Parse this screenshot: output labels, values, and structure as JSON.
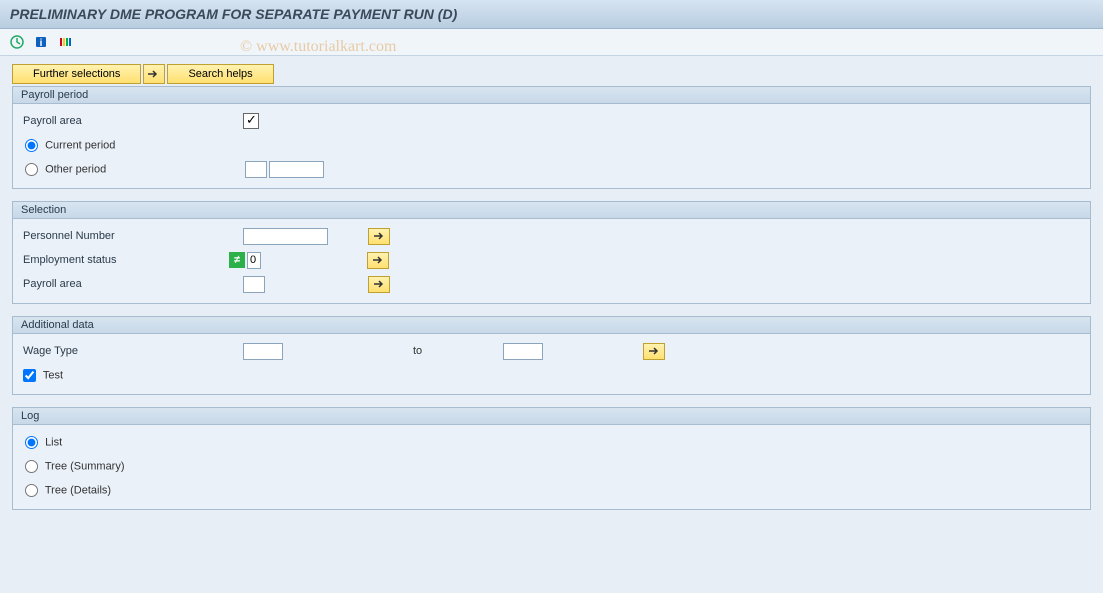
{
  "title": "PRELIMINARY DME PROGRAM FOR SEPARATE PAYMENT RUN (D)",
  "watermark": "© www.tutorialkart.com",
  "toolbar": {
    "execute_icon": "execute",
    "info_icon": "info",
    "layout_icon": "layout"
  },
  "buttons": {
    "further_selections": "Further selections",
    "search_helps": "Search helps"
  },
  "groups": {
    "payroll_period": {
      "title": "Payroll period",
      "payroll_area_label": "Payroll area",
      "payroll_area_checked": true,
      "current_period_label": "Current period",
      "current_period_selected": true,
      "other_period_label": "Other period",
      "other_period_selected": false,
      "other_period_value1": "",
      "other_period_value2": ""
    },
    "selection": {
      "title": "Selection",
      "personnel_number_label": "Personnel Number",
      "personnel_number_value": "",
      "employment_status_label": "Employment status",
      "employment_status_value": "0",
      "payroll_area_label": "Payroll area",
      "payroll_area_value": ""
    },
    "additional_data": {
      "title": "Additional data",
      "wage_type_label": "Wage Type",
      "wage_type_from": "",
      "to_label": "to",
      "wage_type_to": "",
      "test_label": "Test",
      "test_checked": true
    },
    "log": {
      "title": "Log",
      "list_label": "List",
      "list_selected": true,
      "tree_summary_label": "Tree (Summary)",
      "tree_summary_selected": false,
      "tree_details_label": "Tree (Details)",
      "tree_details_selected": false
    }
  }
}
